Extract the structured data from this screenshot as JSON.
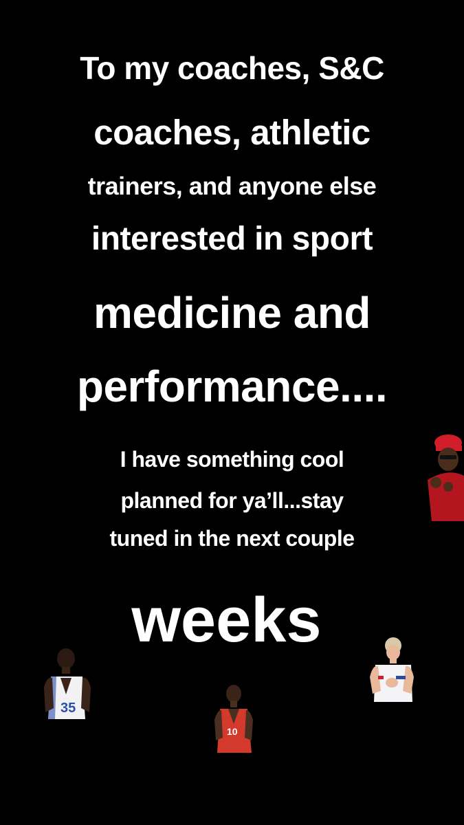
{
  "story": {
    "lines": [
      "To my coaches, S&C",
      "coaches, athletic",
      "trainers, and anyone else",
      "interested in sport",
      "medicine and",
      "performance....",
      "I have something cool",
      "planned for ya’ll...stay",
      "tuned in the next couple",
      "weeks"
    ]
  },
  "stickers": [
    {
      "name": "man-in-red-hat-sticker",
      "colors": {
        "hat": "#d21e2a",
        "jacket": "#b3161f"
      }
    },
    {
      "name": "basketball-player-35-sticker",
      "jersey_number": "35",
      "colors": {
        "jersey": "#f2f2f5",
        "trim": "#2a4fa8"
      }
    },
    {
      "name": "basketball-player-10-sticker",
      "jersey_number": "10",
      "colors": {
        "jersey": "#d33a2c"
      }
    },
    {
      "name": "soccer-player-clapping-sticker",
      "colors": {
        "shirt": "#f4f4f6",
        "accent": "#2c4aa0"
      }
    }
  ],
  "colors": {
    "background": "#000000",
    "text": "#ffffff"
  }
}
